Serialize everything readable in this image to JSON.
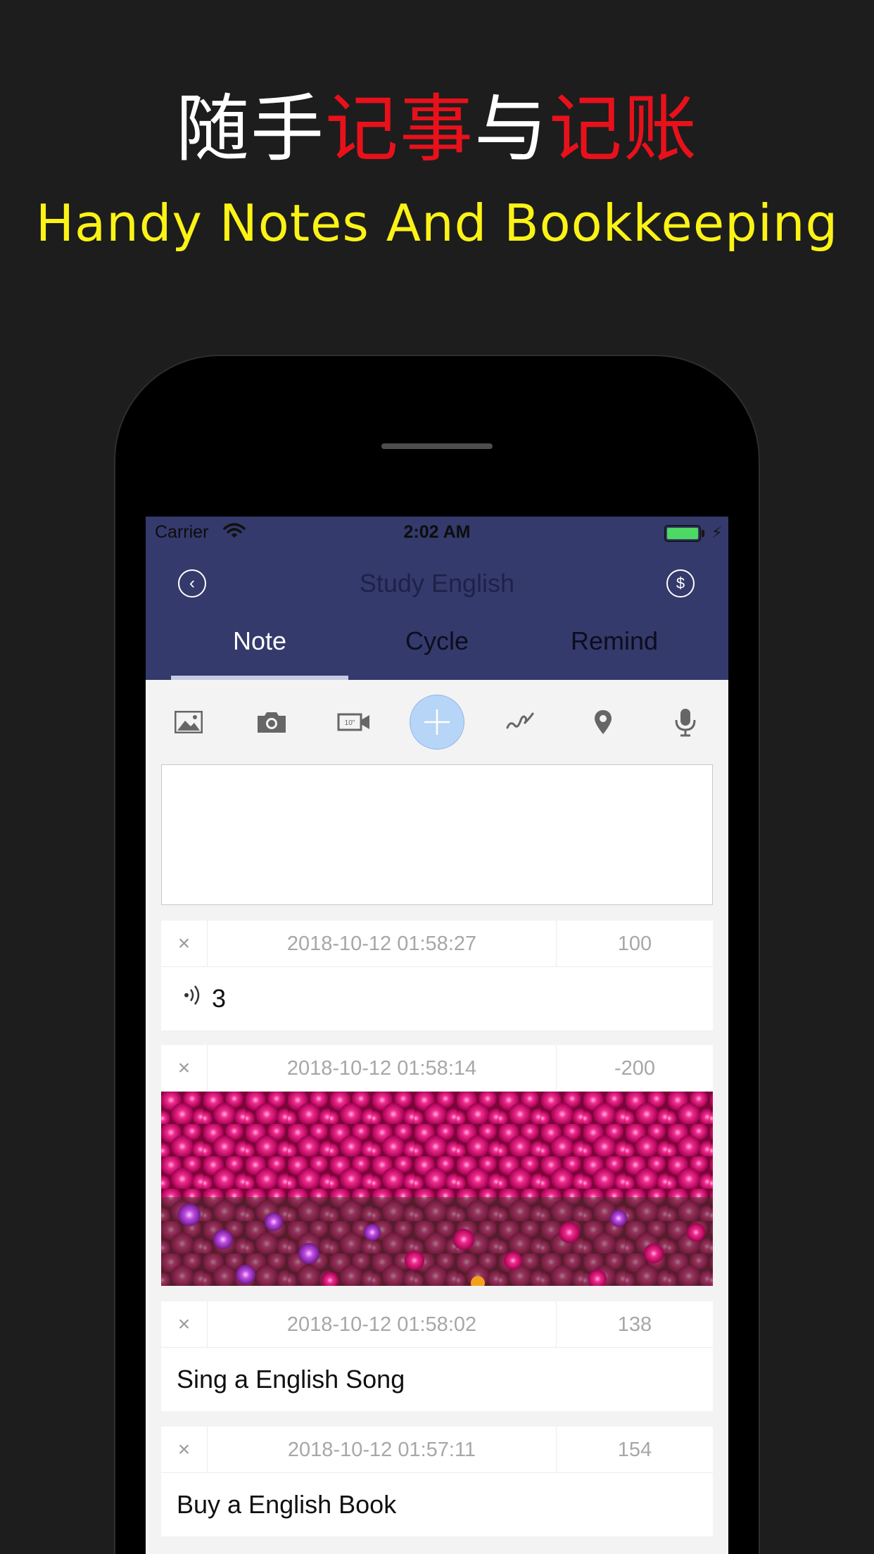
{
  "promo": {
    "headline_parts": [
      "随手",
      "记事",
      "与",
      "记账"
    ],
    "subtitle": "Handy Notes And Bookkeeping"
  },
  "status_bar": {
    "carrier": "Carrier",
    "time": "2:02 AM"
  },
  "navbar": {
    "title": "Study English",
    "back_icon": "chevron-left-icon",
    "right_icon": "dollar-coin-icon"
  },
  "tabs": [
    {
      "label": "Note",
      "selected": true
    },
    {
      "label": "Cycle",
      "selected": false
    },
    {
      "label": "Remind",
      "selected": false
    }
  ],
  "toolbar": {
    "icons": [
      "image-icon",
      "camera-icon",
      "video-icon",
      "plus-icon",
      "signature-icon",
      "location-pin-icon",
      "microphone-icon"
    ],
    "video_badge": "10\""
  },
  "editor": {
    "value": ""
  },
  "entries": [
    {
      "date": "2018-10-12 01:58:27",
      "amount": "100",
      "type": "audio",
      "text": "3"
    },
    {
      "date": "2018-10-12 01:58:14",
      "amount": "-200",
      "type": "photo",
      "text": ""
    },
    {
      "date": "2018-10-12 01:58:02",
      "amount": "138",
      "type": "text",
      "text": "Sing a English Song"
    },
    {
      "date": "2018-10-12 01:57:11",
      "amount": "154",
      "type": "text",
      "text": "Buy a English Book"
    }
  ],
  "delete_symbol": "×",
  "colors": {
    "background": "#1d1d1d",
    "headline_white": "#ffffff",
    "headline_red": "#e8111b",
    "subtitle_yellow": "#fcf316",
    "navbar": "#343a6b",
    "plus_button": "#b7d5f7"
  }
}
